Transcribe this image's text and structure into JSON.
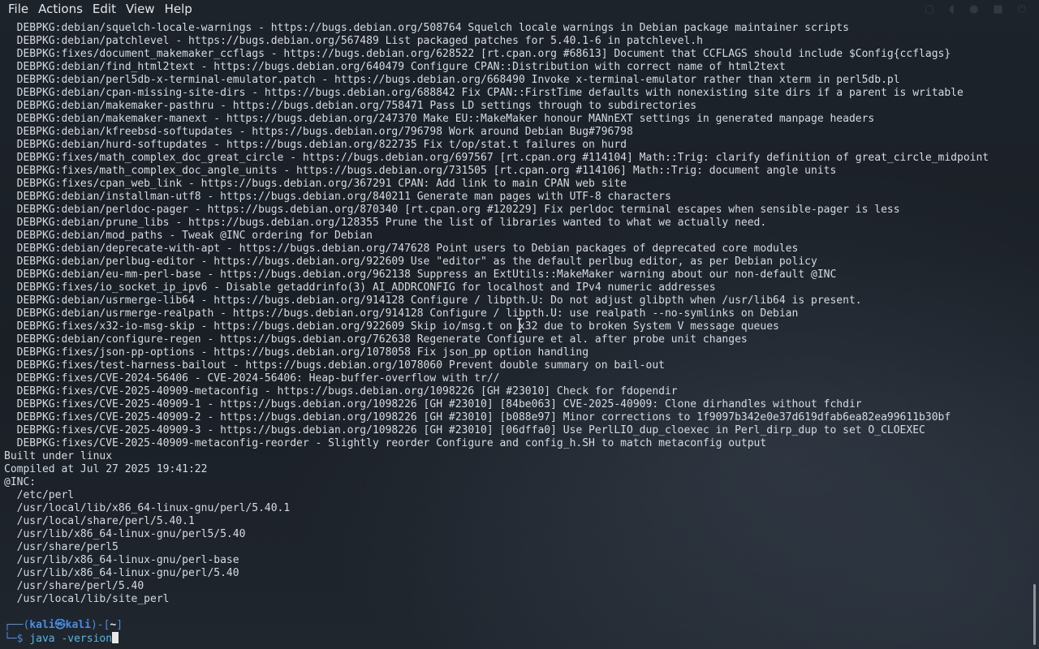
{
  "menu": {
    "items": [
      "File",
      "Actions",
      "Edit",
      "View",
      "Help"
    ]
  },
  "terminal": {
    "lines": [
      "  DEBPKG:debian/squelch-locale-warnings - https://bugs.debian.org/508764 Squelch locale warnings in Debian package maintainer scripts",
      "  DEBPKG:debian/patchlevel - https://bugs.debian.org/567489 List packaged patches for 5.40.1-6 in patchlevel.h",
      "  DEBPKG:fixes/document_makemaker_ccflags - https://bugs.debian.org/628522 [rt.cpan.org #68613] Document that CCFLAGS should include $Config{ccflags}",
      "  DEBPKG:debian/find_html2text - https://bugs.debian.org/640479 Configure CPAN::Distribution with correct name of html2text",
      "  DEBPKG:debian/perl5db-x-terminal-emulator.patch - https://bugs.debian.org/668490 Invoke x-terminal-emulator rather than xterm in perl5db.pl",
      "  DEBPKG:debian/cpan-missing-site-dirs - https://bugs.debian.org/688842 Fix CPAN::FirstTime defaults with nonexisting site dirs if a parent is writable",
      "  DEBPKG:debian/makemaker-pasthru - https://bugs.debian.org/758471 Pass LD settings through to subdirectories",
      "  DEBPKG:debian/makemaker-manext - https://bugs.debian.org/247370 Make EU::MakeMaker honour MANnEXT settings in generated manpage headers",
      "  DEBPKG:debian/kfreebsd-softupdates - https://bugs.debian.org/796798 Work around Debian Bug#796798",
      "  DEBPKG:debian/hurd-softupdates - https://bugs.debian.org/822735 Fix t/op/stat.t failures on hurd",
      "  DEBPKG:fixes/math_complex_doc_great_circle - https://bugs.debian.org/697567 [rt.cpan.org #114104] Math::Trig: clarify definition of great_circle_midpoint",
      "  DEBPKG:fixes/math_complex_doc_angle_units - https://bugs.debian.org/731505 [rt.cpan.org #114106] Math::Trig: document angle units",
      "  DEBPKG:fixes/cpan_web_link - https://bugs.debian.org/367291 CPAN: Add link to main CPAN web site",
      "  DEBPKG:debian/installman-utf8 - https://bugs.debian.org/840211 Generate man pages with UTF-8 characters",
      "  DEBPKG:debian/perldoc-pager - https://bugs.debian.org/870340 [rt.cpan.org #120229] Fix perldoc terminal escapes when sensible-pager is less",
      "  DEBPKG:debian/prune_libs - https://bugs.debian.org/128355 Prune the list of libraries wanted to what we actually need.",
      "  DEBPKG:debian/mod_paths - Tweak @INC ordering for Debian",
      "  DEBPKG:debian/deprecate-with-apt - https://bugs.debian.org/747628 Point users to Debian packages of deprecated core modules",
      "  DEBPKG:debian/perlbug-editor - https://bugs.debian.org/922609 Use \"editor\" as the default perlbug editor, as per Debian policy",
      "  DEBPKG:debian/eu-mm-perl-base - https://bugs.debian.org/962138 Suppress an ExtUtils::MakeMaker warning about our non-default @INC",
      "  DEBPKG:fixes/io_socket_ip_ipv6 - Disable getaddrinfo(3) AI_ADDRCONFIG for localhost and IPv4 numeric addresses",
      "  DEBPKG:debian/usrmerge-lib64 - https://bugs.debian.org/914128 Configure / libpth.U: Do not adjust glibpth when /usr/lib64 is present.",
      "  DEBPKG:debian/usrmerge-realpath - https://bugs.debian.org/914128 Configure / libpth.U: use realpath --no-symlinks on Debian",
      "  DEBPKG:fixes/x32-io-msg-skip - https://bugs.debian.org/922609 Skip io/msg.t on x32 due to broken System V message queues",
      "  DEBPKG:debian/configure-regen - https://bugs.debian.org/762638 Regenerate Configure et al. after probe unit changes",
      "  DEBPKG:fixes/json-pp-options - https://bugs.debian.org/1078058 Fix json_pp option handling",
      "  DEBPKG:fixes/test-harness-bailout - https://bugs.debian.org/1078060 Prevent double summary on bail-out",
      "  DEBPKG:fixes/CVE-2024-56406 - CVE-2024-56406: Heap-buffer-overflow with tr//",
      "  DEBPKG:fixes/CVE-2025-40909-metaconfig - https://bugs.debian.org/1098226 [GH #23010] Check for fdopendir",
      "  DEBPKG:fixes/CVE-2025-40909-1 - https://bugs.debian.org/1098226 [GH #23010] [84be063] CVE-2025-40909: Clone dirhandles without fchdir",
      "  DEBPKG:fixes/CVE-2025-40909-2 - https://bugs.debian.org/1098226 [GH #23010] [b088e97] Minor corrections to 1f9097b342e0e37d619dfab6ea82ea99611b30bf",
      "  DEBPKG:fixes/CVE-2025-40909-3 - https://bugs.debian.org/1098226 [GH #23010] [06dffa0] Use PerlLIO_dup_cloexec in Perl_dirp_dup to set O_CLOEXEC",
      "  DEBPKG:fixes/CVE-2025-40909-metaconfig-reorder - Slightly reorder Configure and config_h.SH to match metaconfig output",
      "Built under linux",
      "Compiled at Jul 27 2025 19:41:22",
      "@INC:",
      "  /etc/perl",
      "  /usr/local/lib/x86_64-linux-gnu/perl/5.40.1",
      "  /usr/local/share/perl/5.40.1",
      "  /usr/lib/x86_64-linux-gnu/perl5/5.40",
      "  /usr/share/perl5",
      "  /usr/lib/x86_64-linux-gnu/perl-base",
      "  /usr/lib/x86_64-linux-gnu/perl/5.40",
      "  /usr/share/perl/5.40",
      "  /usr/local/lib/site_perl",
      ""
    ],
    "prompt": {
      "corner_top": "┌──(",
      "user_host": "kali㉿kali",
      "bracket_mid": ")-[",
      "cwd": "~",
      "bracket_end": "]",
      "corner_bottom": "└─",
      "symbol": "$ ",
      "command": "java -version"
    }
  },
  "colors": {
    "accent": "#4b8de3",
    "command": "#57b7e6",
    "text": "#d6dbe0",
    "background": "#1a1f26"
  }
}
